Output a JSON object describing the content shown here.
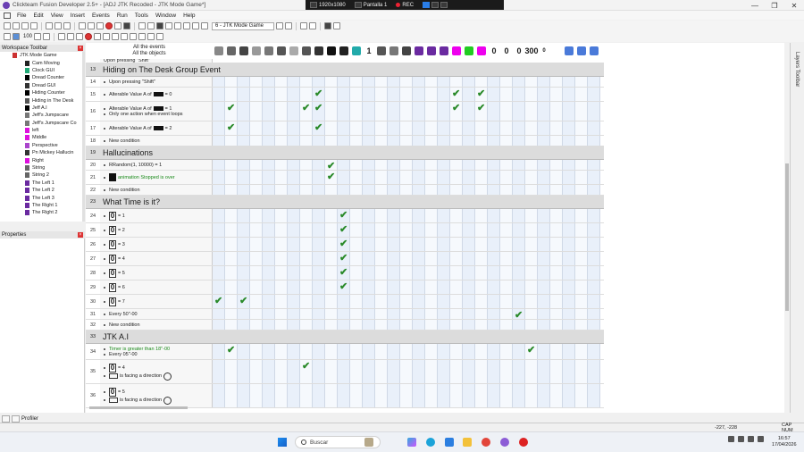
{
  "window": {
    "title": "Clickteam Fusion Developer 2.5+ - [ADJ JTK Recoded - JTK Mode Game*]",
    "controls": [
      "—",
      "❐",
      "✕"
    ]
  },
  "recorder": {
    "resolution": "1920x1080",
    "screen": "Pantalla 1",
    "rec": "REC"
  },
  "menu": [
    "File",
    "Edit",
    "View",
    "Insert",
    "Events",
    "Run",
    "Tools",
    "Window",
    "Help"
  ],
  "toolbar": {
    "frame_select": "6 - JTK Mode Game",
    "zoom": "100"
  },
  "workspace": {
    "title": "Workspace Toolbar",
    "root": "JTK Mode Game",
    "items": [
      {
        "label": "Cam Moving",
        "color": "#222"
      },
      {
        "label": "Clock GUI",
        "color": "#2a7"
      },
      {
        "label": "Dread Counter",
        "color": "#000"
      },
      {
        "label": "Dread GUI",
        "color": "#333"
      },
      {
        "label": "Hiding Counter",
        "color": "#000"
      },
      {
        "label": "Hiding in The Desk",
        "color": "#555"
      },
      {
        "label": "Jeff A.I",
        "color": "#000"
      },
      {
        "label": "Jeff's Jumpscare",
        "color": "#777"
      },
      {
        "label": "Jeff's Jumpscare Co",
        "color": "#777"
      },
      {
        "label": "left",
        "color": "#d1d"
      },
      {
        "label": "Middle",
        "color": "#d1d"
      },
      {
        "label": "Perspective",
        "color": "#a4c"
      },
      {
        "label": "Pn Mickey Hallucin",
        "color": "#333"
      },
      {
        "label": "Right",
        "color": "#d1d"
      },
      {
        "label": "String",
        "color": "#666"
      },
      {
        "label": "String 2",
        "color": "#666"
      },
      {
        "label": "The Left 1",
        "color": "#6a2aa0"
      },
      {
        "label": "The Left 2",
        "color": "#6a2aa0"
      },
      {
        "label": "The Left 3",
        "color": "#6a2aa0"
      },
      {
        "label": "The Right 1",
        "color": "#6a2aa0"
      },
      {
        "label": "The Right 2",
        "color": "#6a2aa0"
      }
    ]
  },
  "properties": {
    "title": "Properties"
  },
  "profiler": {
    "label": "Profiler"
  },
  "editor": {
    "header_all_events": "All the events",
    "header_all_objects": "All the objects",
    "object_columns": [
      {
        "name": "special-icon",
        "color": "#888"
      },
      {
        "name": "sound-icon",
        "color": "#666"
      },
      {
        "name": "storyboard-icon",
        "color": "#444"
      },
      {
        "name": "timer-icon",
        "color": "#999"
      },
      {
        "name": "create-icon",
        "color": "#777"
      },
      {
        "name": "mouse-icon",
        "color": "#555"
      },
      {
        "name": "player-icon",
        "color": "#aaa"
      },
      {
        "name": "keyboard-icon",
        "color": "#555"
      },
      {
        "name": "string-icon",
        "color": "#333"
      },
      {
        "name": "black-bar-icon",
        "color": "#111"
      },
      {
        "name": "desk-icon",
        "color": "#222"
      },
      {
        "name": "sprite-icon",
        "color": "#2aa"
      },
      {
        "name": "counter-icon",
        "color": "#333"
      },
      {
        "name": "sprite2-icon",
        "color": "#555"
      },
      {
        "name": "sprite3-icon",
        "color": "#777"
      },
      {
        "name": "sprite4-icon",
        "color": "#444"
      },
      {
        "name": "purple-icon",
        "color": "#6a2aa0"
      },
      {
        "name": "purple2-icon",
        "color": "#6a2aa0"
      },
      {
        "name": "purple3-icon",
        "color": "#6a2aa0"
      },
      {
        "name": "magenta-icon",
        "color": "#e0e"
      },
      {
        "name": "green-icon",
        "color": "#2c2"
      },
      {
        "name": "magenta2-icon",
        "color": "#e0e"
      },
      {
        "name": "counter1-icon",
        "color": "#000"
      },
      {
        "name": "counter0-icon",
        "color": "#000"
      },
      {
        "name": "counter0b-icon",
        "color": "#000"
      },
      {
        "name": "counter0c-icon",
        "color": "#000"
      },
      {
        "name": "counter300-icon",
        "color": "#000"
      },
      {
        "name": "counter0d-icon",
        "color": "#000"
      },
      {
        "name": "perspective-icon",
        "color": "#4a7ad9"
      },
      {
        "name": "string-obj-icon",
        "color": "#4a7ad9"
      },
      {
        "name": "string-obj2-icon",
        "color": "#4a7ad9"
      }
    ],
    "object_labels": [
      "1",
      "0",
      "0",
      "0",
      "300",
      "0"
    ],
    "rows": [
      {
        "kind": "partial",
        "text": "Upon pressing \"Shift\""
      },
      {
        "kind": "group",
        "num": "13",
        "title": "Hiding on The Desk Group Event"
      },
      {
        "kind": "event",
        "num": "14",
        "lines": [
          {
            "text": "Upon pressing \"Shift\""
          }
        ],
        "checks": [],
        "h": 12
      },
      {
        "kind": "event",
        "num": "15",
        "lines": [
          {
            "pre": "Alterable Value A of",
            "box": "black",
            "text": "= 0"
          }
        ],
        "checks": [
          8,
          19,
          21
        ]
      },
      {
        "kind": "event",
        "num": "16",
        "lines": [
          {
            "pre": "Alterable Value A of",
            "box": "black",
            "text": "= 1"
          },
          {
            "text": "Only one action when event loops"
          }
        ],
        "checks": [
          1,
          7,
          8,
          19,
          21
        ],
        "h": 22
      },
      {
        "kind": "event",
        "num": "17",
        "lines": [
          {
            "pre": "Alterable Value A of",
            "box": "black",
            "text": "= 2"
          }
        ],
        "checks": [
          1,
          8
        ]
      },
      {
        "kind": "event",
        "num": "18",
        "lines": [
          {
            "text": "New condition"
          }
        ],
        "checks": [],
        "h": 12
      },
      {
        "kind": "group",
        "num": "19",
        "title": "Hallucinations"
      },
      {
        "kind": "event",
        "num": "20",
        "lines": [
          {
            "text": "RRandom(1, 10000) = 1"
          }
        ],
        "checks": [
          9
        ],
        "h": 12
      },
      {
        "kind": "event",
        "num": "21",
        "lines": [
          {
            "box": "sprite",
            "text": "animation Stopped is over",
            "green": true
          }
        ],
        "checks": [
          9
        ]
      },
      {
        "kind": "event",
        "num": "22",
        "lines": [
          {
            "text": "New condition"
          }
        ],
        "checks": [],
        "h": 12
      },
      {
        "kind": "group",
        "num": "23",
        "title": "What Time is it?"
      },
      {
        "kind": "event",
        "num": "24",
        "lines": [
          {
            "box": "zero",
            "text": "= 1"
          }
        ],
        "checks": [
          10
        ]
      },
      {
        "kind": "event",
        "num": "25",
        "lines": [
          {
            "box": "zero",
            "text": "= 2"
          }
        ],
        "checks": [
          10
        ]
      },
      {
        "kind": "event",
        "num": "26",
        "lines": [
          {
            "box": "zero",
            "text": "= 3"
          }
        ],
        "checks": [
          10
        ]
      },
      {
        "kind": "event",
        "num": "27",
        "lines": [
          {
            "box": "zero",
            "text": "= 4"
          }
        ],
        "checks": [
          10
        ]
      },
      {
        "kind": "event",
        "num": "28",
        "lines": [
          {
            "box": "zero",
            "text": "= 5"
          }
        ],
        "checks": [
          10
        ]
      },
      {
        "kind": "event",
        "num": "29",
        "lines": [
          {
            "box": "zero",
            "text": "= 6"
          }
        ],
        "checks": [
          10
        ]
      },
      {
        "kind": "event",
        "num": "30",
        "lines": [
          {
            "box": "zero",
            "text": "= 7"
          }
        ],
        "checks": [
          0,
          2
        ]
      },
      {
        "kind": "event",
        "num": "31",
        "lines": [
          {
            "text": "Every 50\"-00"
          }
        ],
        "checks": [
          24
        ],
        "h": 12
      },
      {
        "kind": "event",
        "num": "32",
        "lines": [
          {
            "text": "New condition"
          }
        ],
        "checks": [],
        "h": 12
      },
      {
        "kind": "group",
        "num": "33",
        "title": "JTK A.I"
      },
      {
        "kind": "event",
        "num": "34",
        "lines": [
          {
            "text": "Timer is greater than 18\"-00",
            "green": true
          },
          {
            "text": "Every 05\"-00"
          }
        ],
        "checks": [
          1,
          25
        ],
        "h": 18
      },
      {
        "kind": "event",
        "num": "35",
        "lines": [
          {
            "box": "zero",
            "text": "= 4"
          },
          {
            "box": "cam",
            "text": "is facing a direction",
            "clock": true
          }
        ],
        "checks": [
          7
        ],
        "h": 27
      },
      {
        "kind": "event",
        "num": "36",
        "lines": [
          {
            "box": "zero",
            "text": "= 5"
          },
          {
            "box": "cam",
            "text": "is facing a direction",
            "clock": true
          }
        ],
        "checks": [],
        "h": 27
      }
    ]
  },
  "right_panel": {
    "label": "Layers Toolbar"
  },
  "status": {
    "coords": "-227, -228",
    "caps": "CAP NUM"
  },
  "taskbar": {
    "search_placeholder": "Buscar",
    "time": "16:57",
    "date": "17/04/2026"
  }
}
